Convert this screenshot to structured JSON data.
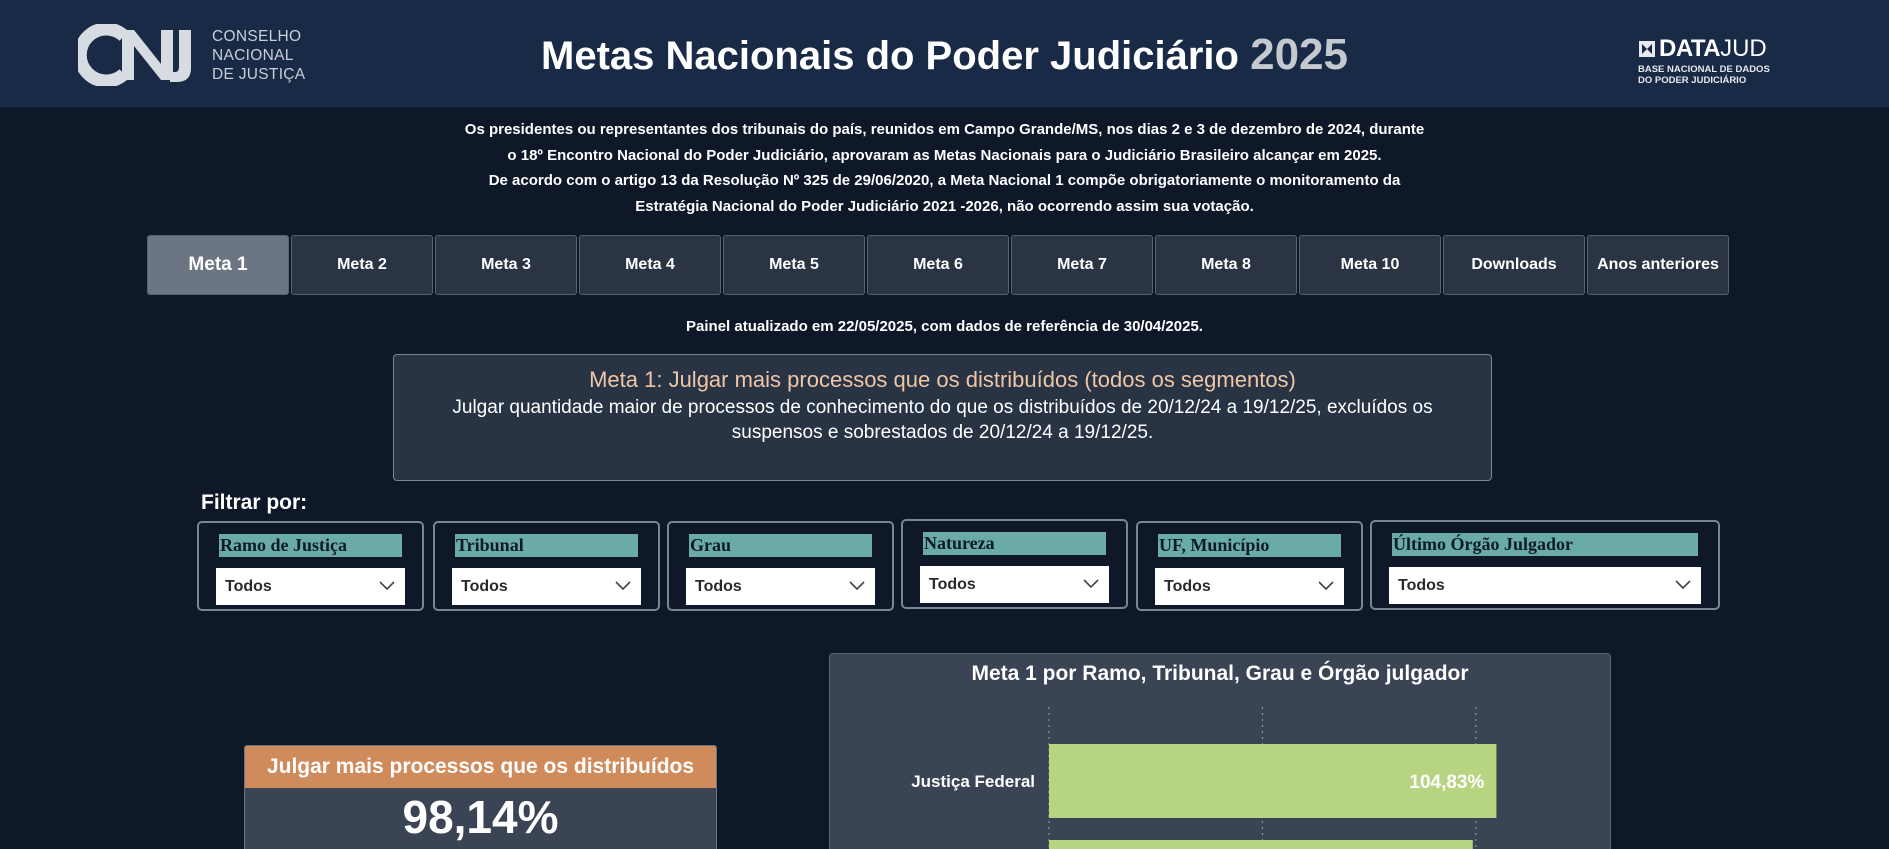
{
  "header": {
    "logo_text": "CNJ",
    "logo_sub": [
      "CONSELHO",
      "NACIONAL",
      "DE JUSTIÇA"
    ],
    "title": "Metas Nacionais do Poder Judiciário",
    "year": "2025",
    "datajud_data": "DATA",
    "datajud_jud": "JUD",
    "datajud_sub": [
      "BASE NACIONAL DE DADOS",
      "DO PODER JUDICIÁRIO"
    ]
  },
  "intro": [
    "Os presidentes ou representantes dos tribunais do país, reunidos em Campo Grande/MS, nos dias 2 e 3 de dezembro de 2024, durante",
    "o 18º Encontro Nacional do Poder Judiciário, aprovaram as Metas Nacionais para o Judiciário Brasileiro alcançar em 2025.",
    "De acordo com o artigo 13 da Resolução Nº 325 de 29/06/2020, a Meta Nacional 1 compõe obrigatoriamente o monitoramento da",
    "Estratégia Nacional do Poder Judiciário 2021 -2026, não ocorrendo assim sua votação."
  ],
  "tabs": [
    {
      "label": "Meta 1",
      "active": true
    },
    {
      "label": "Meta 2"
    },
    {
      "label": "Meta 3"
    },
    {
      "label": "Meta 4"
    },
    {
      "label": "Meta 5"
    },
    {
      "label": "Meta 6"
    },
    {
      "label": "Meta 7"
    },
    {
      "label": "Meta 8"
    },
    {
      "label": "Meta 10"
    },
    {
      "label": "Downloads"
    },
    {
      "label": "Anos anteriores"
    }
  ],
  "updated": "Painel atualizado em 22/05/2025, com dados de referência de 30/04/2025.",
  "meta": {
    "title": "Meta 1: Julgar mais processos que os distribuídos (todos os segmentos)",
    "description": "Julgar quantidade maior de processos de conhecimento do que os distribuídos de 20/12/24 a 19/12/25, excluídos os suspensos e sobrestados de 20/12/24 a 19/12/25."
  },
  "filters": {
    "label": "Filtrar por:",
    "items": [
      {
        "label": "Ramo de Justiça",
        "value": "Todos"
      },
      {
        "label": "Tribunal",
        "value": "Todos"
      },
      {
        "label": "Grau",
        "value": "Todos"
      },
      {
        "label": "Natureza",
        "value": "Todos"
      },
      {
        "label": "UF, Município",
        "value": "Todos"
      },
      {
        "label": "Último Órgão Julgador",
        "value": "Todos"
      }
    ]
  },
  "kpi": {
    "title": "Julgar mais processos que os distribuídos",
    "value": "98,14%"
  },
  "chart_data": {
    "type": "bar",
    "orientation": "horizontal",
    "title": "Meta 1 por Ramo, Tribunal, Grau e Órgão julgador",
    "categories": [
      "Justiça Federal"
    ],
    "values": [
      104.83
    ],
    "data_labels": [
      "104,83%"
    ],
    "bar_color": "#b7d480",
    "grid": "dotted vertical",
    "truncated_below": true
  },
  "colors": {
    "header_bg": "#182a45",
    "page_bg": "#0f1829",
    "kpi_header": "#cf8b5c",
    "filter_label_bg": "#6aaba5",
    "meta_title": "#f0c6a5"
  }
}
